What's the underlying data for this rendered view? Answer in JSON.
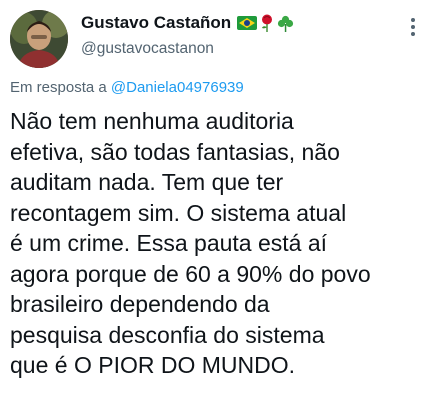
{
  "author": {
    "display_name": "Gustavo Castañon",
    "handle": "@gustavocastanon",
    "badges": [
      "brazil-flag-icon",
      "rose-icon",
      "shamrock-icon"
    ]
  },
  "reply": {
    "prefix": "Em resposta a",
    "mention": "@Daniela04976939"
  },
  "tweet": {
    "lines": [
      "Não tem nenhuma auditoria",
      "efetiva, são todas fantasias, não",
      "auditam nada. Tem que ter",
      "recontagem sim. O sistema atual",
      "é um crime. Essa pauta está aí",
      "agora porque de 60 a 90% do povo",
      "brasileiro dependendo da",
      "pesquisa desconfia do sistema",
      "que é O PIOR DO MUNDO."
    ]
  },
  "colors": {
    "text": "#0f1419",
    "secondary": "#536471",
    "link": "#1d9bf0"
  }
}
